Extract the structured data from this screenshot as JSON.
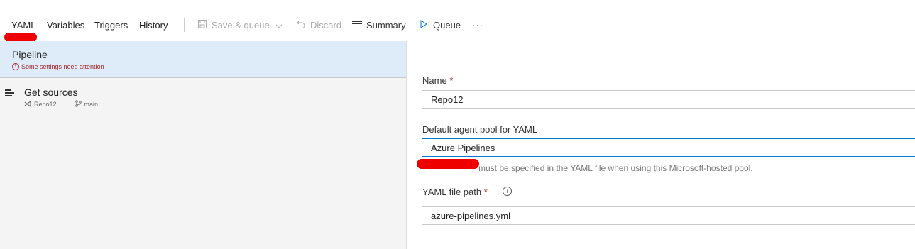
{
  "tabs": [
    {
      "label": "YAML",
      "active": true
    },
    {
      "label": "Variables"
    },
    {
      "label": "Triggers"
    },
    {
      "label": "History"
    }
  ],
  "toolbar": {
    "save_queue_label": "Save & queue",
    "discard_label": "Discard",
    "summary_label": "Summary",
    "queue_label": "Queue",
    "more_label": "···"
  },
  "sidebar": {
    "pipeline_title": "Pipeline",
    "pipeline_warning": "Some settings need attention",
    "get_sources_title": "Get sources",
    "repo": "Repo12",
    "branch": "main"
  },
  "form": {
    "name_label": "Name",
    "name_value": "Repo12",
    "pool_label": "Default agent pool for YAML",
    "pool_value": "Azure Pipelines",
    "pool_hint": "must be specified in the YAML file when using this Microsoft-hosted pool.",
    "yaml_path_label": "YAML file path",
    "yaml_path_value": "azure-pipelines.yml",
    "required_mark": "*"
  },
  "colors": {
    "accent": "#0078d4",
    "warning": "#a4262c",
    "selected_bg": "#deecf9",
    "annotation": "#e00000"
  }
}
